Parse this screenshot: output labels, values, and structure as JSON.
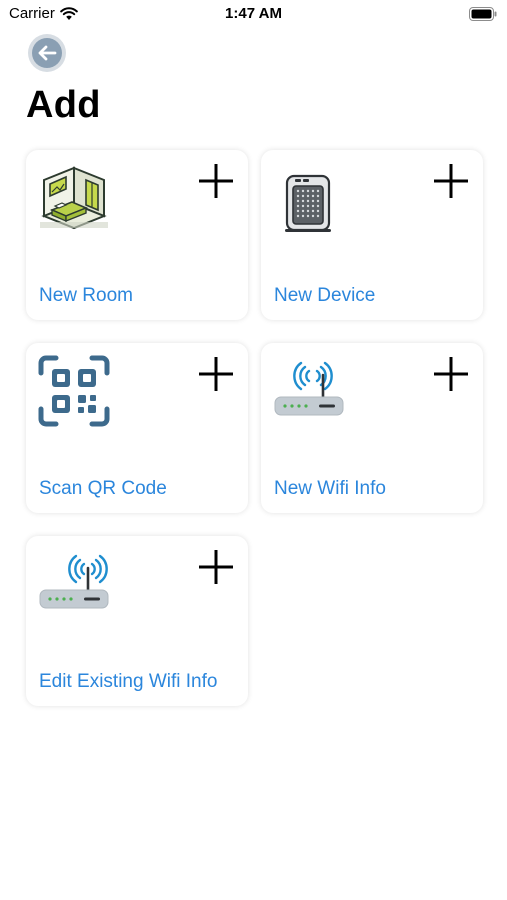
{
  "status_bar": {
    "carrier": "Carrier",
    "time": "1:47 AM"
  },
  "page": {
    "title": "Add"
  },
  "cards": [
    {
      "label": "New Room",
      "icon": "room-icon"
    },
    {
      "label": "New Device",
      "icon": "air-purifier-icon"
    },
    {
      "label": "Scan QR Code",
      "icon": "qr-code-icon"
    },
    {
      "label": "New Wifi Info",
      "icon": "wifi-router-icon"
    },
    {
      "label": "Edit Existing Wifi Info",
      "icon": "wifi-router-icon"
    }
  ],
  "colors": {
    "label": "#2b86dc",
    "back_button": "#8a9fb3",
    "wifi_signal": "#1f8ecf"
  }
}
